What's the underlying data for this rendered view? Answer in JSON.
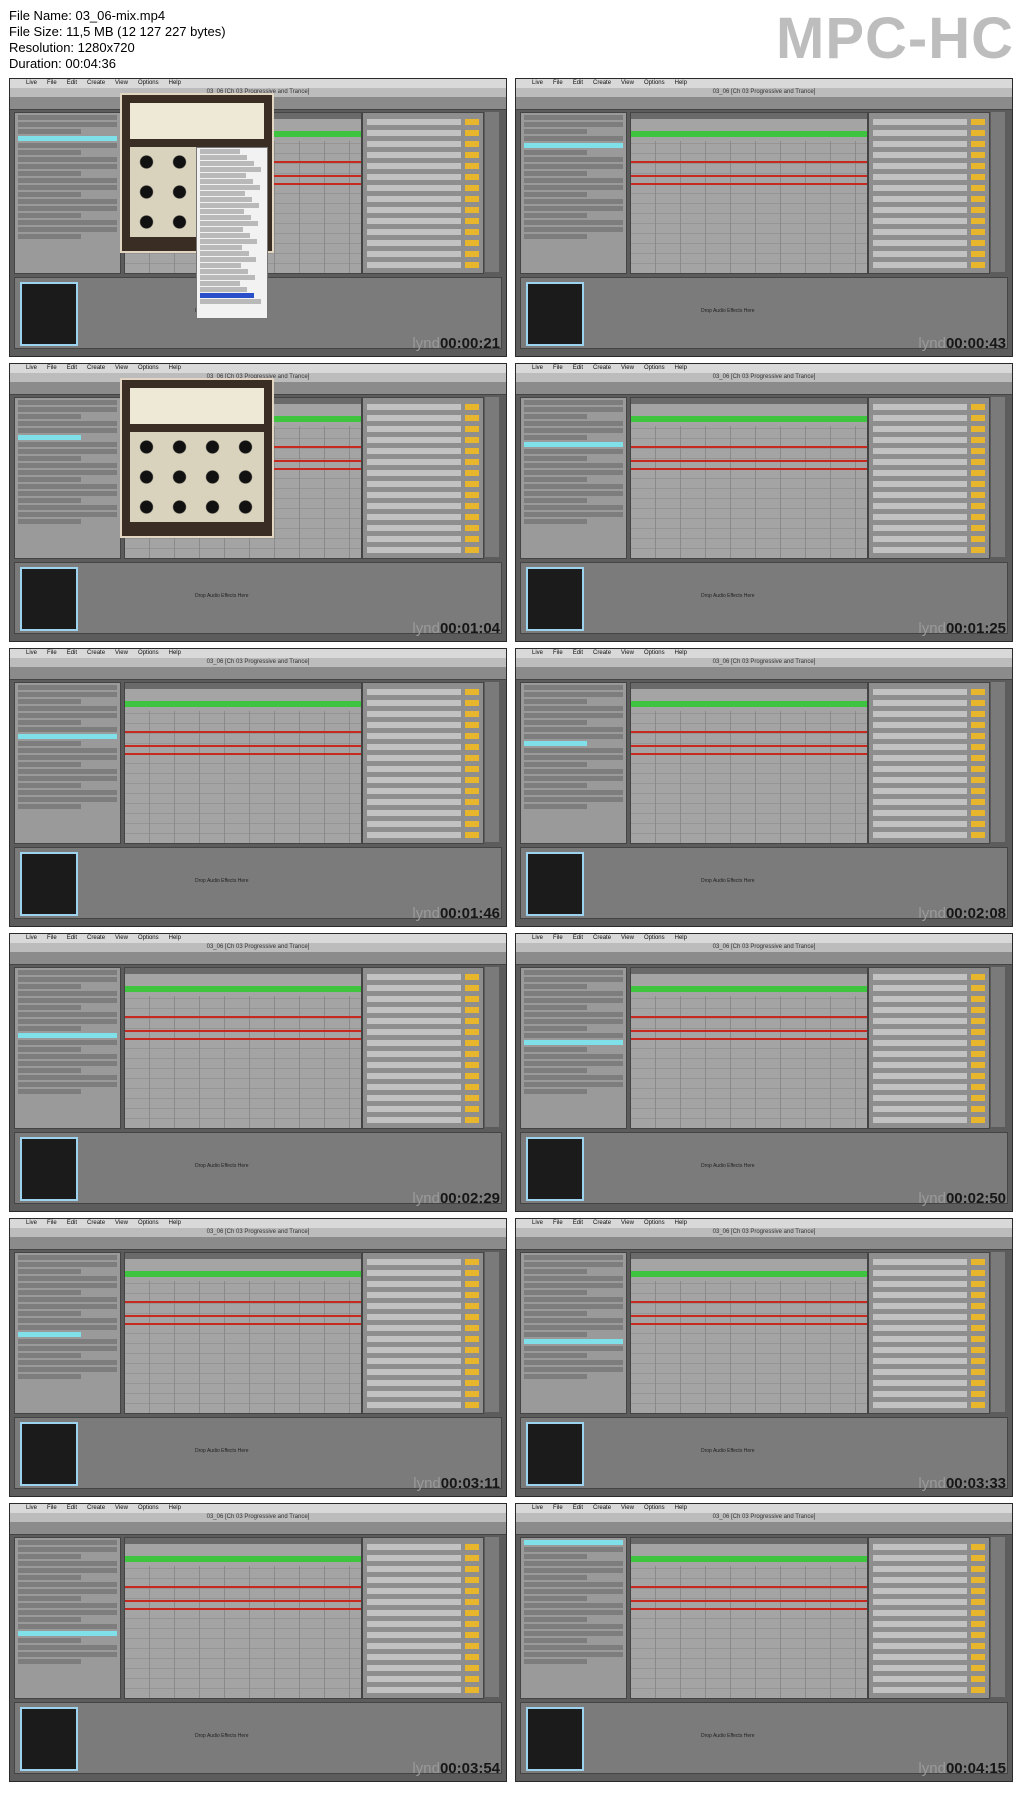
{
  "header": {
    "lines": [
      "File Name: 03_06-mix.mp4",
      "File Size: 11,5 MB (12 127 227 bytes)",
      "Resolution: 1280x720",
      "Duration: 00:04:36"
    ]
  },
  "brand": "MPC-HC",
  "app": {
    "menu": [
      "Live",
      "File",
      "Edit",
      "Create",
      "View",
      "Options",
      "Help"
    ],
    "title": "03_06 [Ch 03 Progressive and Trance]",
    "drop_text": "Drop Audio Effects Here"
  },
  "colors": {
    "clip_green": "#3fc43f",
    "envelope_red": "#c62a1e",
    "selection_cyan": "#7fe0ea",
    "knob_orange": "#e7b62c"
  },
  "watermark": "lynd",
  "thumbnails": [
    {
      "time": "00:00:21",
      "overlay": "plugin-with-menu"
    },
    {
      "time": "00:00:43",
      "overlay": "none"
    },
    {
      "time": "00:01:04",
      "overlay": "plugin"
    },
    {
      "time": "00:01:25",
      "overlay": "none"
    },
    {
      "time": "00:01:46",
      "overlay": "none"
    },
    {
      "time": "00:02:08",
      "overlay": "none"
    },
    {
      "time": "00:02:29",
      "overlay": "none"
    },
    {
      "time": "00:02:50",
      "overlay": "none"
    },
    {
      "time": "00:03:11",
      "overlay": "none"
    },
    {
      "time": "00:03:33",
      "overlay": "none"
    },
    {
      "time": "00:03:54",
      "overlay": "none"
    },
    {
      "time": "00:04:15",
      "overlay": "none"
    }
  ]
}
